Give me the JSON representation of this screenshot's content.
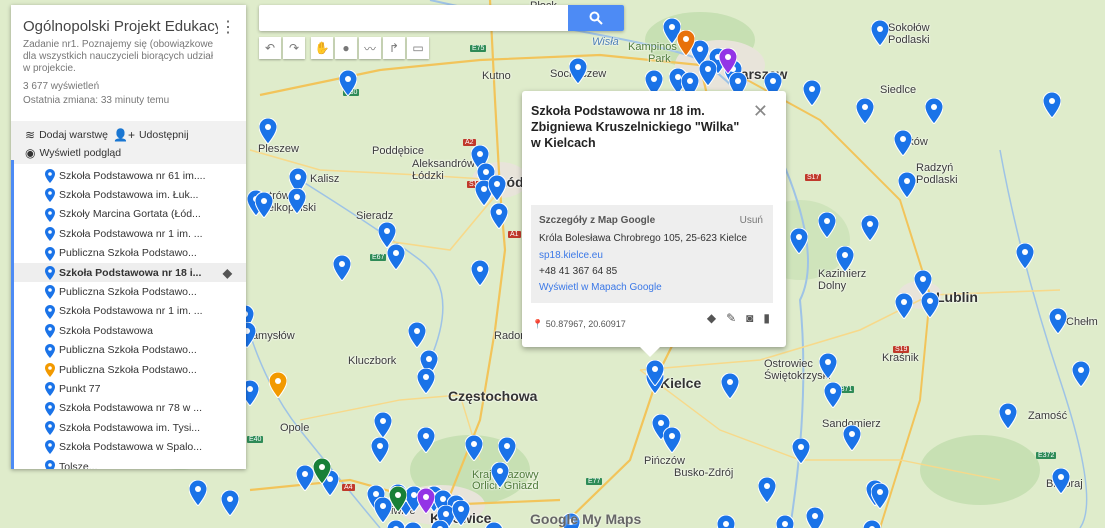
{
  "map": {
    "cities": [
      {
        "name": "Płock",
        "big": false
      },
      {
        "name": "Wisła",
        "big": false
      },
      {
        "name": "Kampinos",
        "big": false
      },
      {
        "name": "Park",
        "big": false
      },
      {
        "name": "Sokołów Podlaski",
        "big": false
      },
      {
        "name": "Sochaczew",
        "big": false
      },
      {
        "name": "Kutno",
        "big": false
      },
      {
        "name": "Warszaw",
        "big": false
      },
      {
        "name": "Siedlce",
        "big": false
      },
      {
        "name": "Pleszew",
        "big": false
      },
      {
        "name": "Poddębice",
        "big": false
      },
      {
        "name": "Aleksandrów Łódzki",
        "big": false
      },
      {
        "name": "Łódź",
        "big": false
      },
      {
        "name": "Kalisz",
        "big": false
      },
      {
        "name": "Ostrów Wielkopolski",
        "big": false
      },
      {
        "name": "Sieradz",
        "big": false
      },
      {
        "name": "Łuków",
        "big": false
      },
      {
        "name": "Radzyń Podlaski",
        "big": false
      },
      {
        "name": "Kazimierz Dolny",
        "big": false
      },
      {
        "name": "Lublin",
        "big": true
      },
      {
        "name": "Chełm",
        "big": false
      },
      {
        "name": "Namysłów",
        "big": false
      },
      {
        "name": "Kluczbork",
        "big": false
      },
      {
        "name": "Radomsko",
        "big": false
      },
      {
        "name": "Kielce",
        "big": true
      },
      {
        "name": "Ostrowiec Świętokrzyski",
        "big": false
      },
      {
        "name": "Kraśnik",
        "big": false
      },
      {
        "name": "Częstochowa",
        "big": true
      },
      {
        "name": "Zamość",
        "big": false
      },
      {
        "name": "Opole",
        "big": false
      },
      {
        "name": "Sandomierz",
        "big": false
      },
      {
        "name": "Krajobrazowy Orlich Gniazd",
        "big": false
      },
      {
        "name": "Pińczów",
        "big": false
      },
      {
        "name": "Busko-Zdrój",
        "big": false
      },
      {
        "name": "Gliwice",
        "big": false
      },
      {
        "name": "Katowice",
        "big": true
      },
      {
        "name": "Bilgoraj",
        "big": false
      }
    ],
    "roads": [
      "E75",
      "E30",
      "A2",
      "S14",
      "A1",
      "E67",
      "S7",
      "S17",
      "S19",
      "E40",
      "A4",
      "E77",
      "E372",
      "E371"
    ],
    "watermark": "Google My Maps"
  },
  "search": {
    "placeholder": ""
  },
  "panel": {
    "title": "Ogólnopolski Projekt Edukacyjny ...",
    "description": "Zadanie nr1. Poznajemy się (obowiązkowe dla wszystkich nauczycieli biorących udział w projekcie.",
    "views": "3 677 wyświetleń",
    "last_change": "Ostatnia zmiana: 33 minuty temu",
    "add_layer": "Dodaj warstwę",
    "share": "Udostępnij",
    "preview": "Wyświetl podgląd",
    "items": [
      {
        "label": "Szkoła Podstawowa nr 61 im....",
        "color": "#1a73e8",
        "selected": false
      },
      {
        "label": "Szkoła Podstawowa im. Łuk...",
        "color": "#1a73e8",
        "selected": false
      },
      {
        "label": "Szkoły Marcina Gortata (Łód...",
        "color": "#1a73e8",
        "selected": false
      },
      {
        "label": "Szkoła Podstawowa nr 1 im. ...",
        "color": "#1a73e8",
        "selected": false
      },
      {
        "label": "Publiczna Szkoła Podstawo...",
        "color": "#1a73e8",
        "selected": false
      },
      {
        "label": "Szkoła Podstawowa nr 18 i...",
        "color": "#1a73e8",
        "selected": true
      },
      {
        "label": "Publiczna Szkoła Podstawo...",
        "color": "#1a73e8",
        "selected": false
      },
      {
        "label": "Szkoła Podstawowa nr 1 im. ...",
        "color": "#1a73e8",
        "selected": false
      },
      {
        "label": "Szkoła Podstawowa",
        "color": "#1a73e8",
        "selected": false
      },
      {
        "label": "Publiczna Szkoła Podstawo...",
        "color": "#1a73e8",
        "selected": false
      },
      {
        "label": "Publiczna Szkoła Podstawo...",
        "color": "#f29900",
        "selected": false
      },
      {
        "label": "Punkt 77",
        "color": "#1a73e8",
        "selected": false
      },
      {
        "label": "Szkoła Podstawowa nr 78 w ...",
        "color": "#1a73e8",
        "selected": false
      },
      {
        "label": "Szkoła Podstawowa im. Tysi...",
        "color": "#1a73e8",
        "selected": false
      },
      {
        "label": "Szkoła Podstawowa w Spalo...",
        "color": "#1a73e8",
        "selected": false
      },
      {
        "label": "Tolsze...",
        "color": "#1a73e8",
        "selected": false
      }
    ]
  },
  "popup": {
    "title": "Szkoła Podstawowa nr 18 im. Zbigniewa Kruszelnickiego \"Wilka\" w Kielcach",
    "details_header": "Szczegóły z Map Google",
    "remove": "Usuń",
    "address": "Króla Bolesława Chrobrego 105, 25-623 Kielce",
    "website": "sp18.kielce.eu",
    "phone": "+48 41 367 64 85",
    "maps_link": "Wyświetl w Mapach Google",
    "coords": "50.87967, 20.60917"
  }
}
